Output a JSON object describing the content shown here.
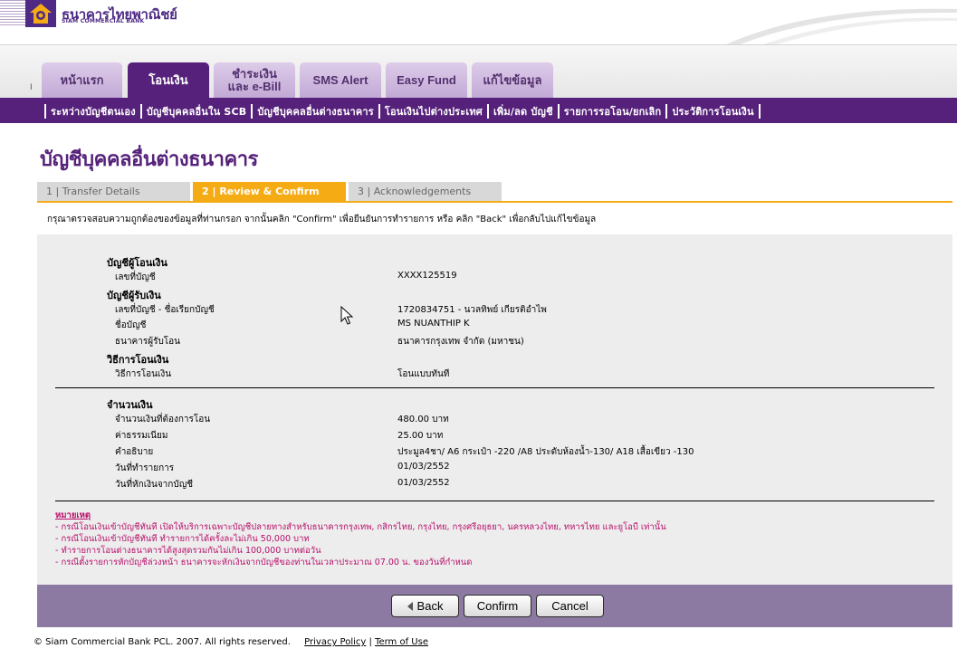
{
  "brand": {
    "name_th": "ธนาคารไทยพาณิชย์",
    "name_en": "SIAM COMMERCIAL BANK",
    "accent": "#56217a",
    "highlight": "#f5ab14",
    "note_color": "#b8106b"
  },
  "main_tabs": [
    {
      "label": "หน้าแรก",
      "active": false
    },
    {
      "label": "โอนเงิน",
      "active": true
    },
    {
      "label": "ชำระเงิน\nและ e-Bill",
      "active": false
    },
    {
      "label": "SMS Alert",
      "active": false
    },
    {
      "label": "Easy Fund",
      "active": false
    },
    {
      "label": "แก้ไขข้อมูล",
      "active": false
    }
  ],
  "side_marker": "I",
  "sub_nav": [
    "ระหว่างบัญชีตนเอง",
    "บัญชีบุคคลอื่นใน SCB",
    "บัญชีบุคคลอื่นต่างธนาคาร",
    "โอนเงินไปต่างประเทศ",
    "เพิ่ม/ลด บัญชี",
    "รายการรอโอน/ยกเลิก",
    "ประวัติการโอนเงิน"
  ],
  "page_title": "บัญชีบุคคลอื่นต่างธนาคาร",
  "steps": [
    {
      "label": "1 | Transfer Details",
      "active": false
    },
    {
      "label": "2 | Review & Confirm",
      "active": true
    },
    {
      "label": "3 | Acknowledgements",
      "active": false
    }
  ],
  "instruction": "กรุณาตรวจสอบความถูกต้องของข้อมูลที่ท่านกรอก จากนั้นคลิก \"Confirm\" เพื่อยืนยันการทำรายการ หรือ คลิก \"Back\" เพื่อกลับไปแก้ไขข้อมูล",
  "details": {
    "from_section": "บัญชีผู้โอนเงิน",
    "from_account_label": "เลขที่บัญชี",
    "from_account_value": "XXXX125519",
    "to_section": "บัญชีผู้รับเงิน",
    "to_account_label": "เลขที่บัญชี - ชื่อเรียกบัญชี",
    "to_account_value": "1720834751 - นวลทิพย์ เกียรติอำไพ",
    "account_name_label": "ชื่อบัญชี",
    "account_name_value": "MS NUANTHIP K",
    "bank_label": "ธนาคารผู้รับโอน",
    "bank_value": "ธนาคารกรุงเทพ จำกัด (มหาชน)",
    "method_section": "วิธีการโอนเงิน",
    "method_label": "วิธีการโอนเงิน",
    "method_value": "โอนแบบทันที",
    "amount_section": "จำนวนเงิน",
    "amount_label": "จำนวนเงินที่ต้องการโอน",
    "amount_value": "480.00  บาท",
    "fee_label": "ค่าธรรมเนียม",
    "fee_value": "25.00  บาท",
    "desc_label": "คำอธิบาย",
    "desc_value": "ประมูล4ชา/ A6 กระเป๋า -220 /A8 ประดับห้องน้ำ-130/ A18 เสื้อเขียว -130",
    "txn_date_label": "วันที่ทำรายการ",
    "txn_date_value": "01/03/2552",
    "debit_date_label": "วันที่หักเงินจากบัญชี",
    "debit_date_value": "01/03/2552"
  },
  "notes": {
    "title": "หมายเหตุ",
    "items": [
      "- กรณีโอนเงินเข้าบัญชีทันที เปิดให้บริการเฉพาะบัญชีปลายทางสำหรับธนาคารกรุงเทพ, กสิกรไทย, กรุงไทย, กรุงศรีอยุธยา, นครหลวงไทย, ทหารไทย และยูโอบี เท่านั้น",
      "- กรณีโอนเงินเข้าบัญชีทันที ทำรายการได้ครั้งละไม่เกิน 50,000 บาท",
      "- ทำรายการโอนต่างธนาคารได้สูงสุดรวมกันไม่เกิน 100,000 บาทต่อวัน",
      "- กรณีตั้งรายการหักบัญชีล่วงหน้า ธนาคารจะหักเงินจากบัญชีของท่านในเวลาประมาณ 07.00 น. ของวันที่กำหนด"
    ]
  },
  "buttons": {
    "back": "Back",
    "confirm": "Confirm",
    "cancel": "Cancel"
  },
  "footer": {
    "copyright": "© Siam Commercial Bank PCL. 2007. All rights reserved.",
    "privacy": "Privacy Policy",
    "divider": "|",
    "terms": "Term of Use"
  }
}
